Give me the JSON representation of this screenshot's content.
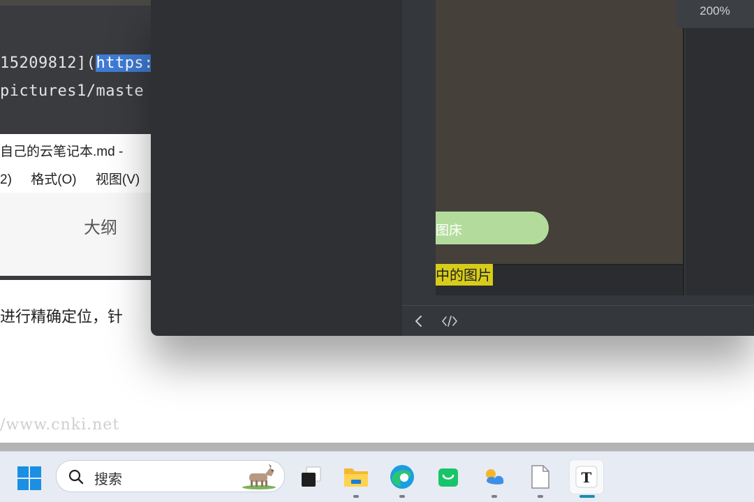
{
  "editor": {
    "line1_before": "15209812](",
    "line1_selected": "https:",
    "line2": "pictures1/maste",
    "embed_title": "自己的云笔记本.md -",
    "embed_menu": [
      "2)",
      "格式(O)",
      "视图(V)"
    ],
    "embed_outline": "大纲"
  },
  "document": {
    "paragraph_fragment": "进行精确定位，针",
    "watermark": "/www.cnki.net"
  },
  "preview_window": {
    "zoom_label": "200%",
    "green_pill_text": "图床",
    "highlight_text": "中的图片",
    "buttons": {
      "back": "chevron-left-icon",
      "source": "code-icon"
    }
  },
  "taskbar": {
    "search_placeholder": "搜索",
    "apps": [
      {
        "name": "task-view-icon"
      },
      {
        "name": "file-explorer-icon"
      },
      {
        "name": "edge-icon"
      },
      {
        "name": "shopping-bag-icon"
      },
      {
        "name": "weather-app-icon"
      },
      {
        "name": "notepad-icon"
      },
      {
        "name": "typora-icon",
        "label": "T"
      }
    ],
    "colors": {
      "accent": "#1d8cb1",
      "windows_blue": "#1a8fe3"
    }
  }
}
